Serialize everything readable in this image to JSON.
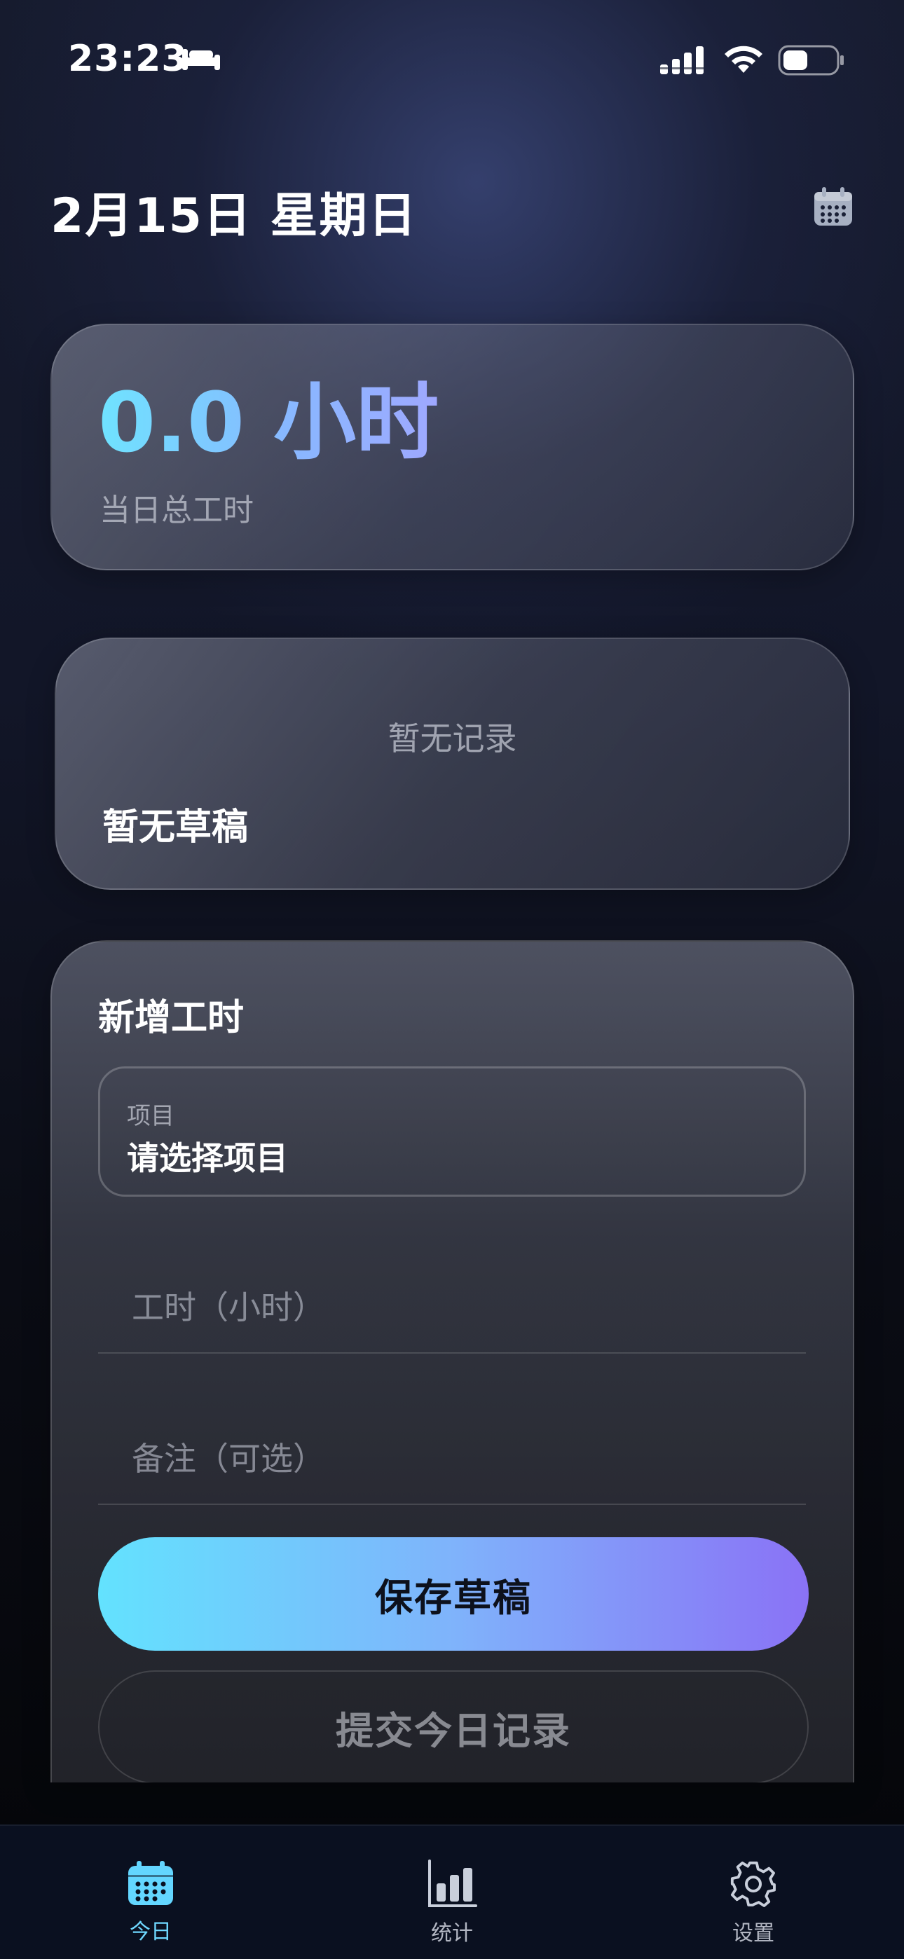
{
  "status_bar": {
    "time": "23:23",
    "icons": [
      "bed-icon",
      "cellular-signal-icon",
      "wifi-icon",
      "battery-icon"
    ]
  },
  "header": {
    "date": "2月15日 星期日",
    "calendar_icon": "calendar-icon"
  },
  "summary": {
    "total_hours": "0.0 小时",
    "total_label": "当日总工时"
  },
  "records": {
    "empty_records": "暂无记录",
    "empty_drafts": "暂无草稿"
  },
  "form": {
    "title": "新增工时",
    "project_caption": "项目",
    "project_value": "请选择项目",
    "hours_placeholder": "工时（小时）",
    "note_placeholder": "备注（可选）",
    "save_label": "保存草稿",
    "submit_label": "提交今日记录"
  },
  "tabs": [
    {
      "label": "今日",
      "icon": "calendar-icon",
      "active": true
    },
    {
      "label": "统计",
      "icon": "bar-chart-icon",
      "active": false
    },
    {
      "label": "设置",
      "icon": "gear-icon",
      "active": false
    }
  ],
  "colors": {
    "accent_cyan": "#63e2fe",
    "accent_violet": "#8a72f6",
    "tab_active": "#6fd8ff"
  }
}
